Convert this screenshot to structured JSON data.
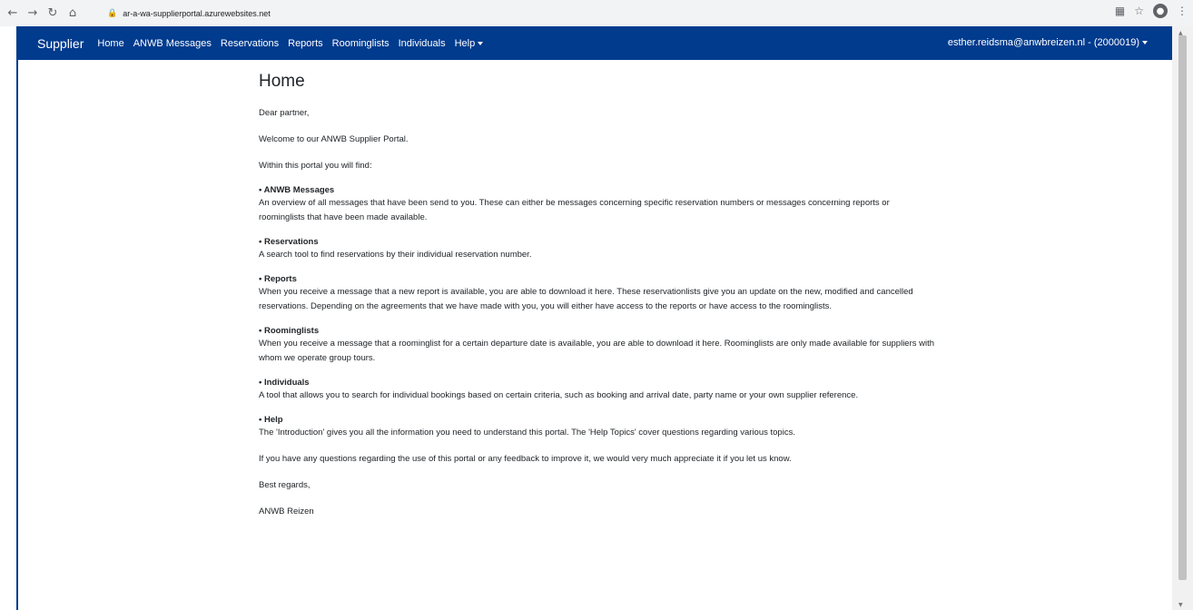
{
  "browser": {
    "url": "ar-a-wa-supplierportal.azurewebsites.net"
  },
  "navbar": {
    "brand": "Supplier",
    "items": [
      "Home",
      "ANWB Messages",
      "Reservations",
      "Reports",
      "Roominglists",
      "Individuals"
    ],
    "help_label": "Help",
    "user": "esther.reidsma@anwbreizen.nl - (2000019)"
  },
  "main": {
    "title": "Home",
    "greeting": "Dear partner,",
    "welcome": "Welcome to our ANWB Supplier Portal.",
    "intro": "Within this portal you will find:",
    "sections": [
      {
        "title": "• ANWB Messages",
        "body": "An overview of all messages that have been send to you. These can either be messages concerning specific reservation numbers or messages concerning reports or roominglists that have been made available."
      },
      {
        "title": "• Reservations",
        "body": "A search tool to find reservations by their individual reservation number."
      },
      {
        "title": "• Reports",
        "body": "When you receive a message that a new report is available, you are able to download it here. These reservationlists give you an update on the new, modified and cancelled reservations. Depending on the agreements that we have made with you, you will either have access to the reports or have access to the roominglists."
      },
      {
        "title": "• Roominglists",
        "body": "When you receive a message that a roominglist for a certain departure date is available, you are able to download it here. Roominglists are only made available for suppliers with whom we operate group tours."
      },
      {
        "title": "• Individuals",
        "body": "A tool that allows you to search for individual bookings based on certain criteria, such as booking and arrival date, party name or your own supplier reference."
      },
      {
        "title": "• Help",
        "body": "The 'Introduction' gives you all the information you need to understand this portal. The 'Help Topics' cover questions regarding various topics."
      }
    ],
    "closing": "If you have any questions regarding the use of this portal or any feedback to improve it, we would very much appreciate it if you let us know.",
    "regards": "Best regards,",
    "signature": "ANWB Reizen"
  },
  "colors": {
    "navbar": "#003b8e"
  }
}
